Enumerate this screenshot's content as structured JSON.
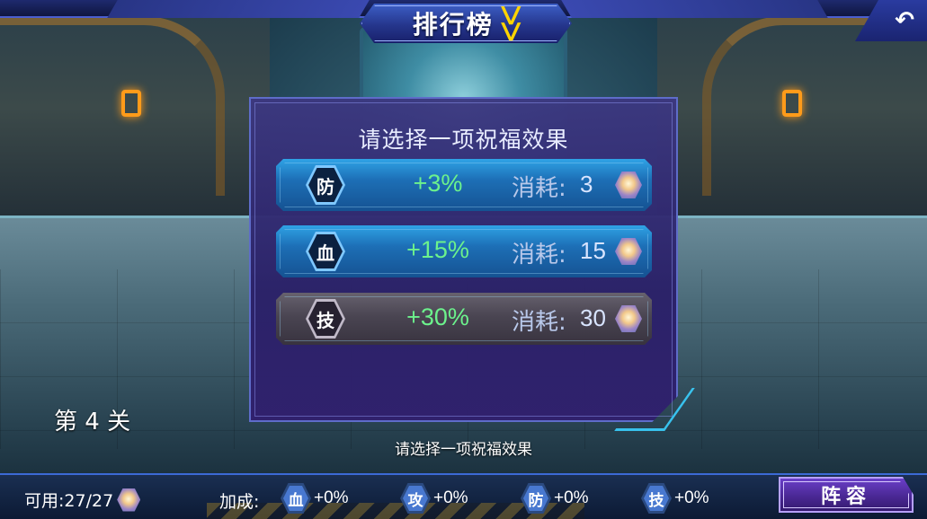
{
  "header": {
    "title": "排行榜",
    "dropdown_icon": "double-chevron-down-icon",
    "back_icon": "return-arrow-icon"
  },
  "dialog": {
    "title": "请选择一项祝福效果",
    "options": [
      {
        "icon": "防",
        "bonus": "+3%",
        "cost_label": "消耗:",
        "cost": "3",
        "style": "blue"
      },
      {
        "icon": "血",
        "bonus": "+15%",
        "cost_label": "消耗:",
        "cost": "15",
        "style": "blue"
      },
      {
        "icon": "技",
        "bonus": "+30%",
        "cost_label": "消耗:",
        "cost": "30",
        "style": "gray"
      }
    ]
  },
  "stage": {
    "label": "第 4 关"
  },
  "hint": "请选择一项祝福效果",
  "footer": {
    "available_label": "可用:27/27",
    "bonus_label": "加成:",
    "bonuses": [
      {
        "icon": "血",
        "value": "+0%"
      },
      {
        "icon": "攻",
        "value": "+0%"
      },
      {
        "icon": "防",
        "value": "+0%"
      },
      {
        "icon": "技",
        "value": "+0%"
      }
    ],
    "lineup_button": "阵容"
  },
  "colors": {
    "bonus_green": "#6cf28c",
    "option_blue": "#1d6fb6",
    "option_gray": "#4a4552",
    "dialog_purple": "#2a2068",
    "title_gold": "#ffd400"
  }
}
